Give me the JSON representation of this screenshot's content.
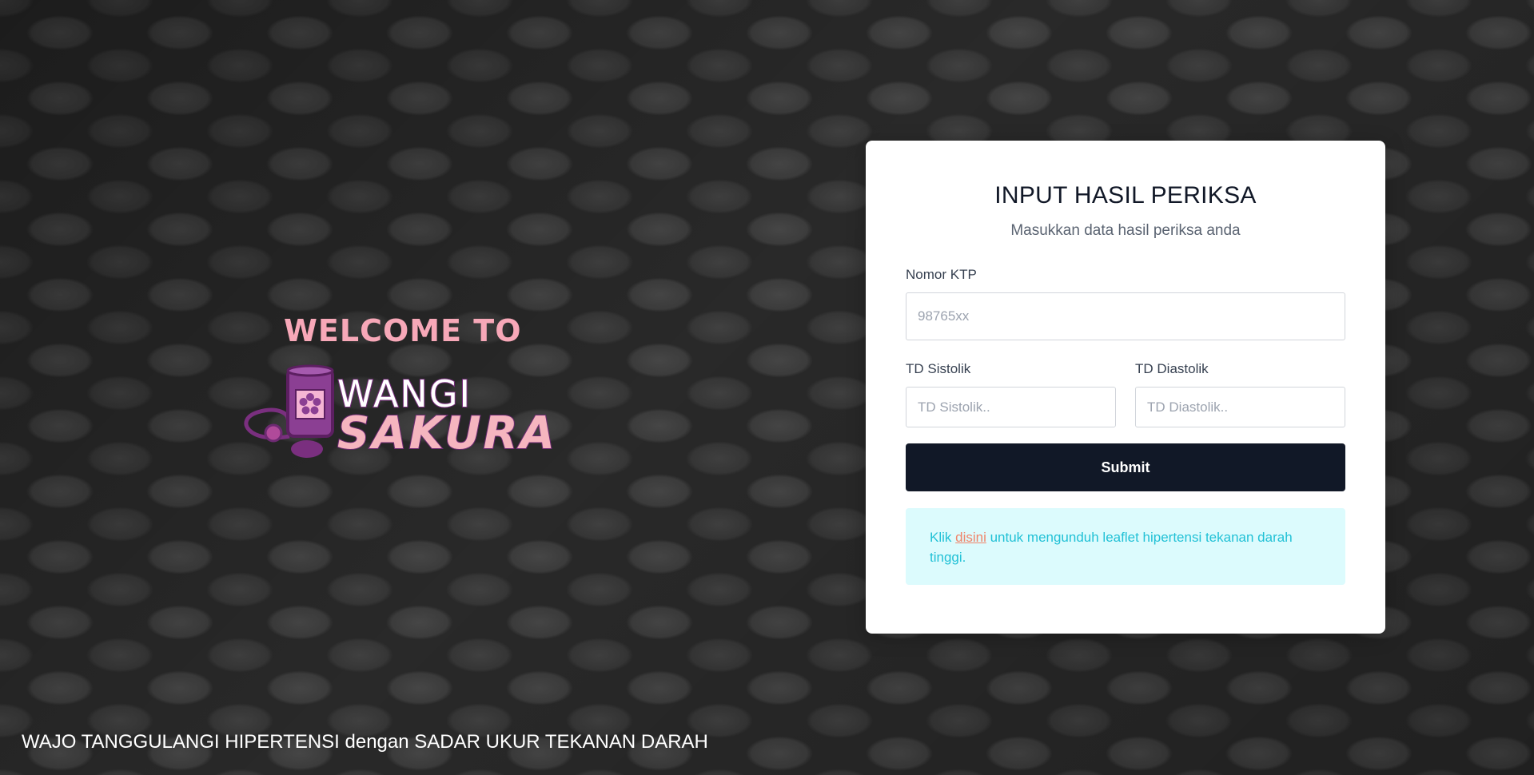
{
  "hero": {
    "welcome": "WELCOME TO",
    "logo_word_top": "WANGI",
    "logo_word_bottom": "SAKURA"
  },
  "footer": {
    "tagline": "WAJO TANGGULANGI HIPERTENSI dengan SADAR UKUR TEKANAN DARAH"
  },
  "form": {
    "title": "INPUT HASIL PERIKSA",
    "subtitle": "Masukkan data hasil periksa anda",
    "ktp_label": "Nomor KTP",
    "ktp_placeholder": "98765xx",
    "sistolik_label": "TD Sistolik",
    "sistolik_placeholder": "TD Sistolik..",
    "diastolik_label": "TD Diastolik",
    "diastolik_placeholder": "TD Diastolik..",
    "submit_label": "Submit"
  },
  "alert": {
    "prefix": "Klik ",
    "link_text": "disini",
    "suffix": " untuk mengunduh leaflet hipertensi tekanan darah tinggi."
  },
  "colors": {
    "accent_pink": "#f7a8b8",
    "logo_purple": "#7a2f7f",
    "button_dark": "#111827",
    "alert_bg": "#dcfbfd",
    "alert_text": "#22c1d6",
    "link_orange": "#f0846a"
  }
}
